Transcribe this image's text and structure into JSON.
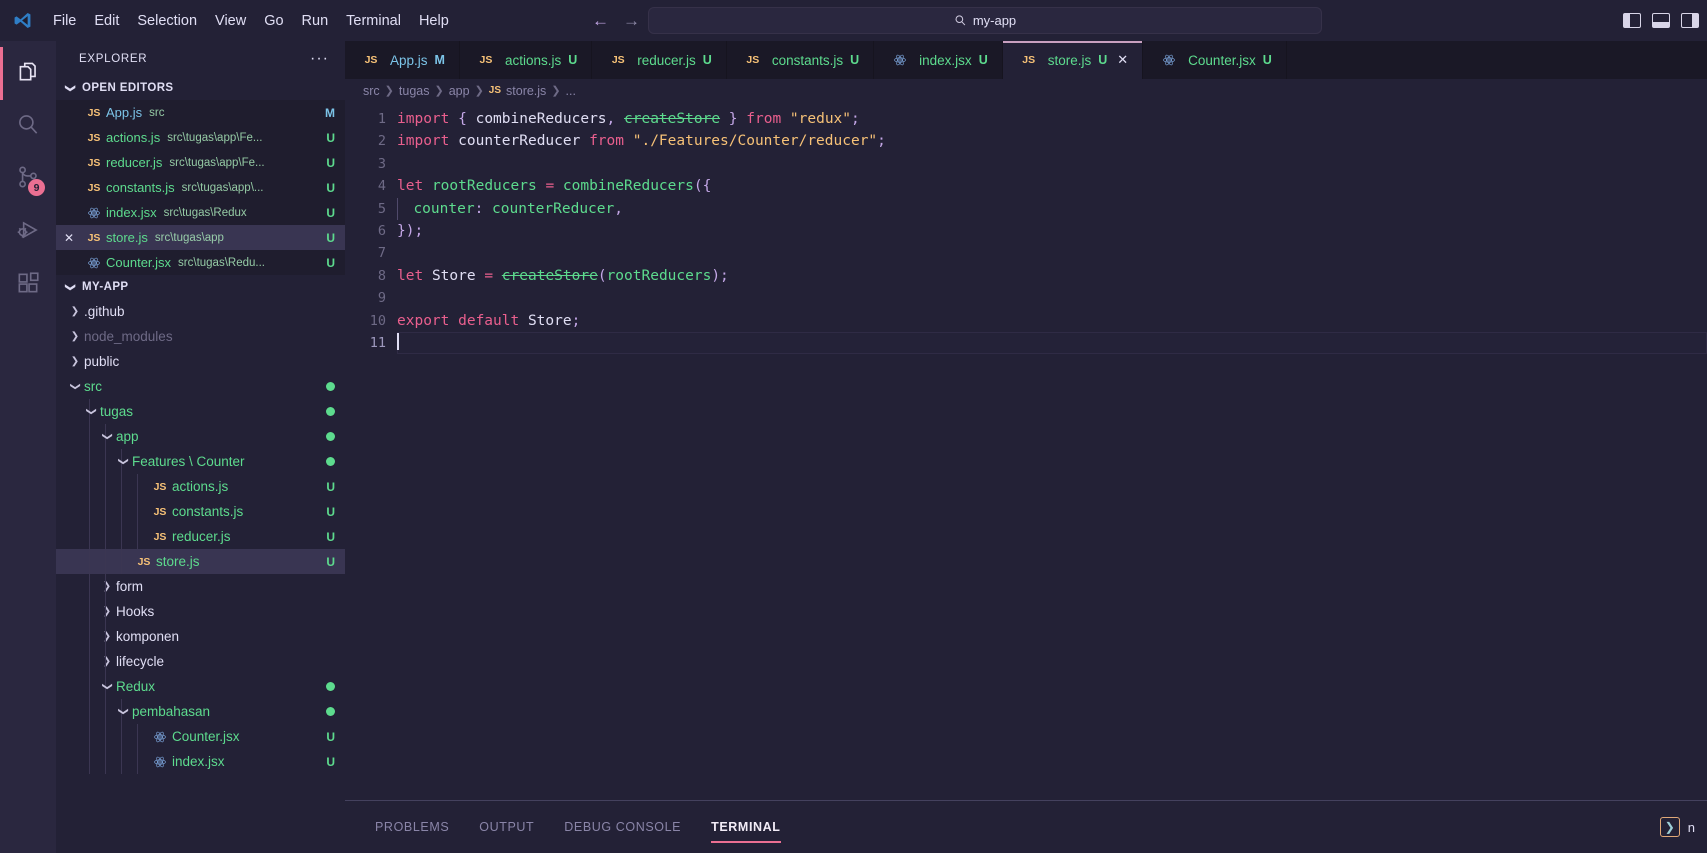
{
  "titlebar": {
    "logo_icon": "vscode-logo-icon",
    "menus": [
      "File",
      "Edit",
      "Selection",
      "View",
      "Go",
      "Run",
      "Terminal",
      "Help"
    ],
    "nav_back_icon": "arrow-left-icon",
    "nav_forward_icon": "arrow-right-icon",
    "command_center": {
      "search_icon": "search-icon",
      "text": "my-app"
    },
    "layout_controls": [
      "toggle-primary-sidebar-icon",
      "toggle-panel-icon",
      "toggle-secondary-sidebar-icon"
    ]
  },
  "activitybar": {
    "items": [
      {
        "name": "explorer",
        "icon": "files-icon",
        "active": true,
        "badge": ""
      },
      {
        "name": "search",
        "icon": "search-icon",
        "active": false,
        "badge": ""
      },
      {
        "name": "source-control",
        "icon": "source-control-icon",
        "active": false,
        "badge": "9"
      },
      {
        "name": "run-and-debug",
        "icon": "debug-icon",
        "active": false,
        "badge": ""
      },
      {
        "name": "extensions",
        "icon": "extensions-icon",
        "active": false,
        "badge": ""
      }
    ]
  },
  "sidebar": {
    "title": "EXPLORER",
    "more_actions": "···",
    "open_editors": {
      "label": "OPEN EDITORS",
      "expanded": true,
      "items": [
        {
          "icon": "js",
          "name": "App.js",
          "path": "src",
          "badge": "M",
          "badge_kind": "m",
          "name_kind": "m",
          "selected": false,
          "show_close": false
        },
        {
          "icon": "js",
          "name": "actions.js",
          "path": "src\\tugas\\app\\Fe...",
          "badge": "U",
          "badge_kind": "u",
          "name_kind": "u",
          "selected": false,
          "show_close": false
        },
        {
          "icon": "js",
          "name": "reducer.js",
          "path": "src\\tugas\\app\\Fe...",
          "badge": "U",
          "badge_kind": "u",
          "name_kind": "u",
          "selected": false,
          "show_close": false
        },
        {
          "icon": "js",
          "name": "constants.js",
          "path": "src\\tugas\\app\\...",
          "badge": "U",
          "badge_kind": "u",
          "name_kind": "u",
          "selected": false,
          "show_close": false
        },
        {
          "icon": "react",
          "name": "index.jsx",
          "path": "src\\tugas\\Redux",
          "badge": "U",
          "badge_kind": "u",
          "name_kind": "u",
          "selected": false,
          "show_close": false
        },
        {
          "icon": "js",
          "name": "store.js",
          "path": "src\\tugas\\app",
          "badge": "U",
          "badge_kind": "u",
          "name_kind": "u",
          "selected": true,
          "show_close": true
        },
        {
          "icon": "react",
          "name": "Counter.jsx",
          "path": "src\\tugas\\Redu...",
          "badge": "U",
          "badge_kind": "u",
          "name_kind": "u",
          "selected": false,
          "show_close": false
        }
      ]
    },
    "workspace": {
      "label": "MY-APP",
      "expanded": true,
      "tree": [
        {
          "depth": 0,
          "kind": "folder",
          "twisty": "collapsed",
          "label": ".github",
          "style": "plain",
          "dot": false,
          "selected": false,
          "badge": ""
        },
        {
          "depth": 0,
          "kind": "folder",
          "twisty": "collapsed",
          "label": "node_modules",
          "style": "dim",
          "dot": false,
          "selected": false,
          "badge": ""
        },
        {
          "depth": 0,
          "kind": "folder",
          "twisty": "collapsed",
          "label": "public",
          "style": "plain",
          "dot": false,
          "selected": false,
          "badge": ""
        },
        {
          "depth": 0,
          "kind": "folder",
          "twisty": "expanded",
          "label": "src",
          "style": "mod",
          "dot": true,
          "selected": false,
          "badge": ""
        },
        {
          "depth": 1,
          "kind": "folder",
          "twisty": "expanded",
          "label": "tugas",
          "style": "mod",
          "dot": true,
          "selected": false,
          "badge": ""
        },
        {
          "depth": 2,
          "kind": "folder",
          "twisty": "expanded",
          "label": "app",
          "style": "mod",
          "dot": true,
          "selected": false,
          "badge": ""
        },
        {
          "depth": 3,
          "kind": "folder",
          "twisty": "expanded",
          "label": "Features \\ Counter",
          "style": "mod",
          "dot": true,
          "selected": false,
          "badge": ""
        },
        {
          "depth": 4,
          "kind": "js",
          "twisty": "none",
          "label": "actions.js",
          "style": "mod",
          "dot": false,
          "selected": false,
          "badge": "U"
        },
        {
          "depth": 4,
          "kind": "js",
          "twisty": "none",
          "label": "constants.js",
          "style": "mod",
          "dot": false,
          "selected": false,
          "badge": "U"
        },
        {
          "depth": 4,
          "kind": "js",
          "twisty": "none",
          "label": "reducer.js",
          "style": "mod",
          "dot": false,
          "selected": false,
          "badge": "U"
        },
        {
          "depth": 3,
          "kind": "js",
          "twisty": "none",
          "label": "store.js",
          "style": "mod",
          "dot": false,
          "selected": true,
          "badge": "U"
        },
        {
          "depth": 2,
          "kind": "folder",
          "twisty": "collapsed",
          "label": "form",
          "style": "plain",
          "dot": false,
          "selected": false,
          "badge": ""
        },
        {
          "depth": 2,
          "kind": "folder",
          "twisty": "collapsed",
          "label": "Hooks",
          "style": "plain",
          "dot": false,
          "selected": false,
          "badge": ""
        },
        {
          "depth": 2,
          "kind": "folder",
          "twisty": "collapsed",
          "label": "komponen",
          "style": "plain",
          "dot": false,
          "selected": false,
          "badge": ""
        },
        {
          "depth": 2,
          "kind": "folder",
          "twisty": "collapsed",
          "label": "lifecycle",
          "style": "plain",
          "dot": false,
          "selected": false,
          "badge": ""
        },
        {
          "depth": 2,
          "kind": "folder",
          "twisty": "expanded",
          "label": "Redux",
          "style": "mod",
          "dot": true,
          "selected": false,
          "badge": ""
        },
        {
          "depth": 3,
          "kind": "folder",
          "twisty": "expanded",
          "label": "pembahasan",
          "style": "mod",
          "dot": true,
          "selected": false,
          "badge": ""
        },
        {
          "depth": 4,
          "kind": "react",
          "twisty": "none",
          "label": "Counter.jsx",
          "style": "mod",
          "dot": false,
          "selected": false,
          "badge": "U"
        },
        {
          "depth": 4,
          "kind": "react",
          "twisty": "none",
          "label": "index.jsx",
          "style": "mod",
          "dot": false,
          "selected": false,
          "badge": "U"
        }
      ]
    }
  },
  "editor": {
    "tabs": [
      {
        "icon": "js",
        "label": "App.js",
        "status": "M",
        "kind": "m",
        "active": false,
        "close": false
      },
      {
        "icon": "js",
        "label": "actions.js",
        "status": "U",
        "kind": "u",
        "active": false,
        "close": false
      },
      {
        "icon": "js",
        "label": "reducer.js",
        "status": "U",
        "kind": "u",
        "active": false,
        "close": false
      },
      {
        "icon": "js",
        "label": "constants.js",
        "status": "U",
        "kind": "u",
        "active": false,
        "close": false
      },
      {
        "icon": "react",
        "label": "index.jsx",
        "status": "U",
        "kind": "u",
        "active": false,
        "close": false
      },
      {
        "icon": "js",
        "label": "store.js",
        "status": "U",
        "kind": "u",
        "active": true,
        "close": true
      },
      {
        "icon": "react",
        "label": "Counter.jsx",
        "status": "U",
        "kind": "u",
        "active": false,
        "close": false
      }
    ],
    "breadcrumb": [
      "src",
      "tugas",
      "app",
      "store.js",
      "..."
    ],
    "breadcrumb_file_icon": "js",
    "line_numbers": [
      "1",
      "2",
      "3",
      "4",
      "5",
      "6",
      "7",
      "8",
      "9",
      "10",
      "11"
    ],
    "current_line": 11,
    "code_lines": [
      "import { combineReducers, createStore } from \"redux\";",
      "import counterReducer from \"./Features/Counter/reducer\";",
      "",
      "let rootReducers = combineReducers({",
      "  counter: counterReducer,",
      "});",
      "",
      "let Store = createStore(rootReducers);",
      "",
      "export default Store;",
      ""
    ]
  },
  "panel": {
    "tabs": [
      {
        "label": "PROBLEMS",
        "active": false
      },
      {
        "label": "OUTPUT",
        "active": false
      },
      {
        "label": "DEBUG CONSOLE",
        "active": false
      },
      {
        "label": "TERMINAL",
        "active": true
      }
    ],
    "right_icon": "terminal-chevron-icon",
    "right_label": "n"
  },
  "colors": {
    "accent_pink": "#eb6f92",
    "editor_bg": "#232136",
    "sidebar_bg": "#232136",
    "tabbar_bg": "#1a1826",
    "activitybar_bg": "#2a273f",
    "untracked_green": "#5ddb8e",
    "modified_blue": "#7cc4e8"
  }
}
